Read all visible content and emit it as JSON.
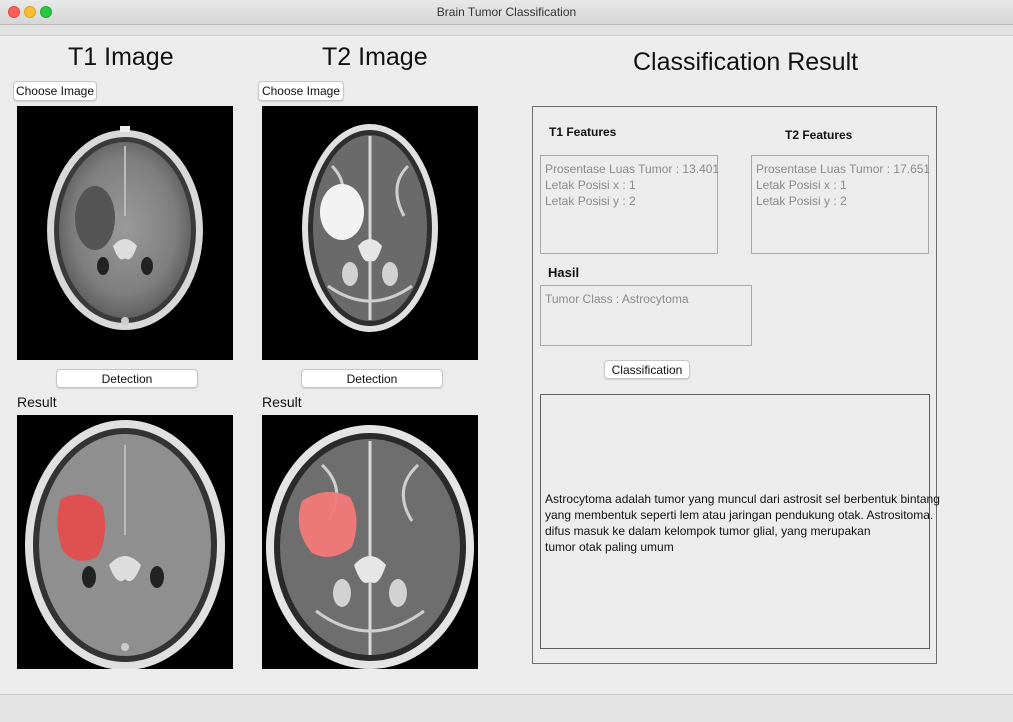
{
  "window": {
    "title": "Brain Tumor Classification"
  },
  "t1": {
    "heading": "T1 Image",
    "choose_label": "Choose Image",
    "detect_label": "Detection",
    "result_label": "Result"
  },
  "t2": {
    "heading": "T2 Image",
    "choose_label": "Choose Image",
    "detect_label": "Detection",
    "result_label": "Result"
  },
  "classification": {
    "heading": "Classification Result",
    "t1_features_label": "T1 Features",
    "t2_features_label": "T2 Features",
    "t1_features": [
      "Prosentase Luas Tumor : 13.401",
      "Letak Posisi x : 1",
      "Letak Posisi y : 2"
    ],
    "t2_features": [
      "Prosentase Luas Tumor : 17.651",
      "Letak Posisi x : 1",
      "Letak Posisi y : 2"
    ],
    "hasil_label": "Hasil",
    "hasil_value": "Tumor Class : Astrocytoma",
    "button_label": "Classification",
    "description": [
      "Astrocytoma adalah tumor yang muncul dari astrosit sel berbentuk bintang",
      "yang membentuk seperti lem atau jaringan pendukung otak. Astrositoma.",
      "difus masuk ke dalam kelompok tumor glial, yang merupakan",
      "tumor otak paling umum"
    ]
  },
  "colors": {
    "tumor_overlay": "#e84a4a",
    "window_bg": "#ececec"
  },
  "icons": [
    "close-icon",
    "minimize-icon",
    "maximize-icon"
  ]
}
